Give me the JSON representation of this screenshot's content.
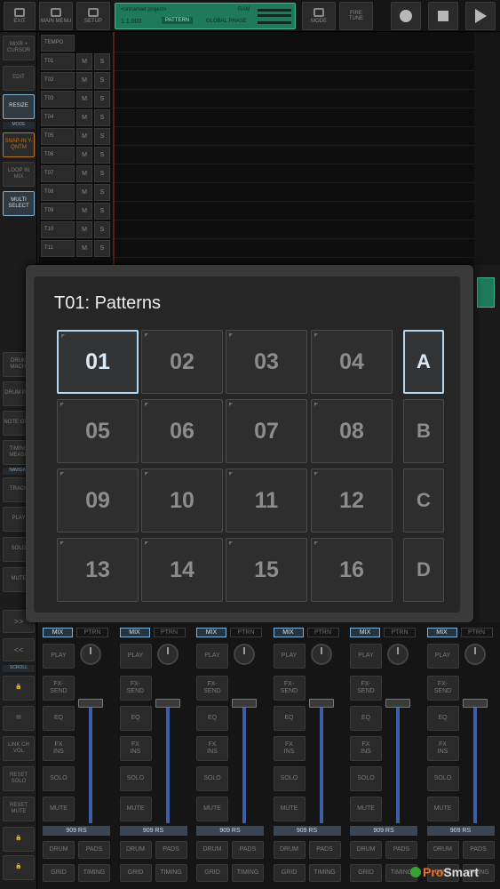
{
  "toolbar": {
    "exit": "EXIT",
    "main_menu": "MAIN MENU",
    "setup": "SETUP",
    "project_name": "<unnamed project>",
    "position": "1.1.000",
    "pattern_label": "PATTERN",
    "ram_label": "RAM",
    "global_phase": "GLOBAL PHASE",
    "mode": "MODE",
    "fire_tune": "FIRE\nTUNE"
  },
  "sidebar": {
    "items": [
      {
        "label": "MIXR + CURSOR"
      },
      {
        "label": "EDIT"
      },
      {
        "label": "RESIZE"
      },
      {
        "label": "SNAP-IN Y-QNTM"
      },
      {
        "label": "LOOP IN MIX"
      },
      {
        "label": "MULTI SELECT"
      }
    ],
    "mode_label": "MODE",
    "lower": [
      {
        "label": "DRUM MACHI"
      },
      {
        "label": "DRUM PAD"
      },
      {
        "label": "NOTE GRID"
      },
      {
        "label": "TIMING MEASU"
      },
      {
        "label": "TRACK"
      },
      {
        "label": "PLAY"
      },
      {
        "label": "SOLO"
      },
      {
        "label": "MUTE"
      },
      {
        "label": ">>"
      },
      {
        "label": "<<"
      },
      {
        "label": "LINK CH VOL"
      },
      {
        "label": "RESET SOLO"
      },
      {
        "label": "RESET MUTE"
      }
    ],
    "navigat_label": "NAVIGAT",
    "scroll_label": "SCROLL"
  },
  "tracks": {
    "tempo_label": "TEMPO",
    "rows": [
      "T01",
      "T02",
      "T03",
      "T04",
      "T05",
      "T06",
      "T07",
      "T08",
      "T09",
      "T10",
      "T11"
    ],
    "mute": "M",
    "solo": "S"
  },
  "dialog": {
    "title": "T01: Patterns",
    "patterns": [
      "01",
      "02",
      "03",
      "04",
      "05",
      "06",
      "07",
      "08",
      "09",
      "10",
      "11",
      "12",
      "13",
      "14",
      "15",
      "16"
    ],
    "selected_pattern": "01",
    "banks": [
      "A",
      "B",
      "C",
      "D"
    ],
    "selected_bank": "A"
  },
  "mixer": {
    "mix_label": "MIX",
    "ptrn_label": "PTRN",
    "play": "PLAY",
    "fx_send": "FX-\nSEND",
    "eq": "EQ",
    "fx_ins": "FX\nINS",
    "solo": "SOLO",
    "mute": "MUTE",
    "preset": "909 RS",
    "drum": "DRUM",
    "pads": "PADS",
    "grid": "GRID",
    "timing": "TIMING",
    "strip_count": 6
  },
  "watermark": {
    "pro": "Pro",
    "smart": "Smart"
  },
  "colors": {
    "accent": "#b6d7f0",
    "status_green": "#1f7a5c",
    "fader_blue": "#3a5fa8"
  }
}
